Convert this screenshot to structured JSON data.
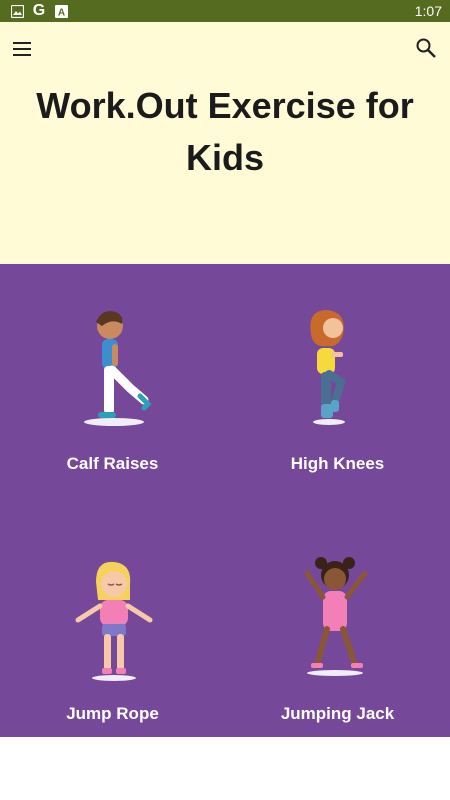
{
  "status_bar": {
    "time": "1:07",
    "icons": [
      "image-icon",
      "google-icon",
      "a-box-icon"
    ],
    "g_glyph": "G",
    "a_glyph": "A",
    "background": "#556b20"
  },
  "header": {
    "title": "Work.Out Exercise for Kids",
    "background": "#fffbd7",
    "menu_icon": "hamburger-menu-icon",
    "search_icon": "search-icon"
  },
  "exercises": {
    "background": "#76489a",
    "items": [
      {
        "label": "Calf Raises",
        "icon": "boy-calf-raise-illustration"
      },
      {
        "label": "High Knees",
        "icon": "girl-high-knees-illustration"
      },
      {
        "label": "Jump Rope",
        "icon": "girl-jump-rope-illustration"
      },
      {
        "label": "Jumping Jack",
        "icon": "girl-jumping-jack-illustration"
      }
    ]
  }
}
